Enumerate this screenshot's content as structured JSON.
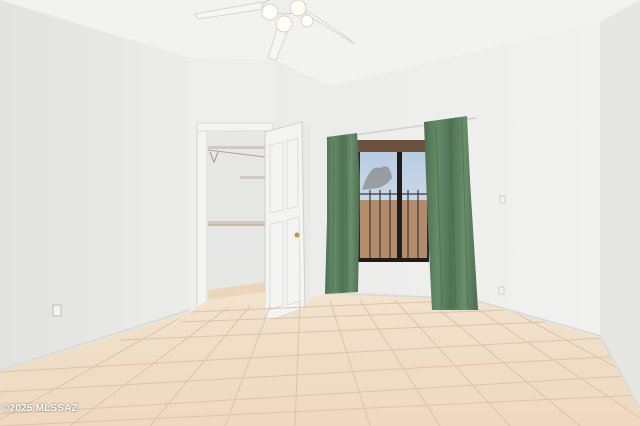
{
  "watermark": {
    "text": "©2025 MLSSAZ"
  },
  "palette": {
    "ceiling": "#f1f1ef",
    "left_wall": "#e6e6e3",
    "back_wall": "#eeeeec",
    "right_wall": "#e9e9e6",
    "tile": "#f0dcc3",
    "grout": "#d8c2a6",
    "curtain": "#5f8461",
    "curtain_shadow": "#48684b",
    "door": "#f3f3f1",
    "window_frame": "#1e1d1c",
    "window_wall_outside": "#b48c6b",
    "sky": "#c9d7e6"
  },
  "scene": {
    "description_icons": [
      "ceiling-fan-icon",
      "window-icon",
      "door-icon",
      "closet-icon",
      "outlet-icon"
    ]
  }
}
